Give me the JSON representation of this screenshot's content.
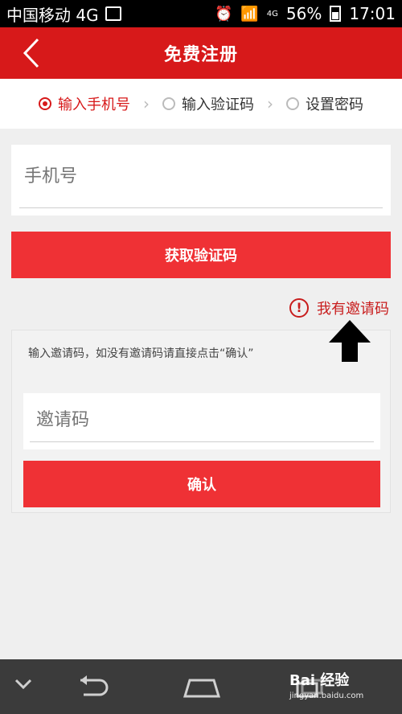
{
  "status_bar": {
    "carrier": "中国移动 4G",
    "signal_label": "4G",
    "battery": "56%",
    "time": "17:01"
  },
  "app_bar": {
    "title": "免费注册",
    "back_icon": "chevron-left-icon"
  },
  "steps": [
    {
      "label": "输入手机号",
      "active": true
    },
    {
      "label": "输入验证码",
      "active": false
    },
    {
      "label": "设置密码",
      "active": false
    }
  ],
  "phone": {
    "placeholder": "手机号",
    "value": ""
  },
  "get_code_button": "获取验证码",
  "invite": {
    "toggle_label": "我有邀请码",
    "hint": "输入邀请码，如没有邀请码请直接点击“确认”",
    "placeholder": "邀请码",
    "value": "",
    "confirm_label": "确认"
  },
  "watermark": {
    "text": "Bai 经验",
    "sub": "jingyan.baidu.com"
  },
  "colors": {
    "brand_red": "#d7191a",
    "button_red": "#ef3135",
    "background": "#efefef"
  }
}
